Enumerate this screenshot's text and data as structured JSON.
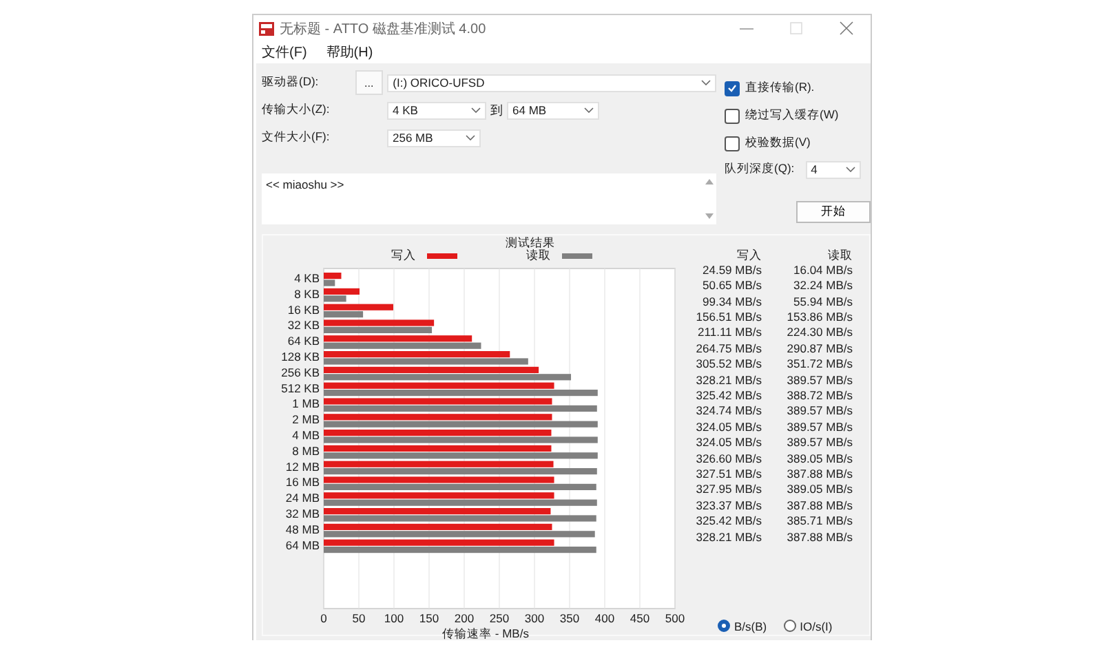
{
  "window": {
    "title": "无标题 - ATTO 磁盘基准测试 4.00"
  },
  "menu": [
    "文件(F)",
    "帮助(H)"
  ],
  "drive": {
    "label": "驱动器(D):",
    "browse_button": "...",
    "value": "(I:) ORICO-UFSD"
  },
  "transfer_size": {
    "label": "传输大小(Z):",
    "from": "4 KB",
    "to_label": "到",
    "to": "64 MB"
  },
  "file_size": {
    "label": "文件大小(F):",
    "value": "256 MB"
  },
  "options": [
    {
      "label": "直接传输(R).",
      "checked": true
    },
    {
      "label": "绕过写入缓存(W)",
      "checked": false
    },
    {
      "label": "校验数据(V)",
      "checked": false
    }
  ],
  "queue_depth": {
    "label": "队列深度(Q):",
    "value": "4"
  },
  "description": "<< miaoshu >>",
  "start_button": "开始",
  "results": {
    "chart_data": {
      "type": "bar",
      "orientation": "horizontal",
      "title": "测试结果",
      "xlabel": "传输速率 - MB/s",
      "categories": [
        "4 KB",
        "8 KB",
        "16 KB",
        "32 KB",
        "64 KB",
        "128 KB",
        "256 KB",
        "512 KB",
        "1 MB",
        "2 MB",
        "4 MB",
        "8 MB",
        "12 MB",
        "16 MB",
        "24 MB",
        "32 MB",
        "48 MB",
        "64 MB"
      ],
      "series": [
        {
          "name": "写入",
          "color": "#e21b1b",
          "values": [
            25,
            51,
            99,
            157,
            211,
            265,
            306,
            328,
            325,
            325,
            324,
            324,
            327,
            328,
            328,
            323,
            325,
            328
          ]
        },
        {
          "name": "读取",
          "color": "#808080",
          "values": [
            16,
            32,
            56,
            154,
            224,
            291,
            352,
            390,
            389,
            390,
            390,
            390,
            389,
            388,
            389,
            388,
            386,
            388
          ]
        }
      ],
      "xlim": [
        0,
        500
      ],
      "grid": true,
      "xticks": [
        0,
        50,
        100,
        150,
        200,
        250,
        300,
        350,
        400,
        450,
        500
      ]
    },
    "columns": [
      "写入",
      "读取"
    ],
    "rows": [
      [
        "24.59 MB/s",
        "16.04 MB/s"
      ],
      [
        "50.65 MB/s",
        "32.24 MB/s"
      ],
      [
        "99.34 MB/s",
        "55.94 MB/s"
      ],
      [
        "156.51 MB/s",
        "153.86 MB/s"
      ],
      [
        "211.11 MB/s",
        "224.30 MB/s"
      ],
      [
        "264.75 MB/s",
        "290.87 MB/s"
      ],
      [
        "305.52 MB/s",
        "351.72 MB/s"
      ],
      [
        "328.21 MB/s",
        "389.57 MB/s"
      ],
      [
        "325.42 MB/s",
        "388.72 MB/s"
      ],
      [
        "324.74 MB/s",
        "389.57 MB/s"
      ],
      [
        "324.05 MB/s",
        "389.57 MB/s"
      ],
      [
        "324.05 MB/s",
        "389.57 MB/s"
      ],
      [
        "326.60 MB/s",
        "389.05 MB/s"
      ],
      [
        "327.51 MB/s",
        "387.88 MB/s"
      ],
      [
        "327.95 MB/s",
        "389.05 MB/s"
      ],
      [
        "323.37 MB/s",
        "387.88 MB/s"
      ],
      [
        "325.42 MB/s",
        "385.71 MB/s"
      ],
      [
        "328.21 MB/s",
        "387.88 MB/s"
      ]
    ]
  },
  "units": [
    {
      "label": "B/s(B)",
      "selected": true
    },
    {
      "label": "IO/s(I)",
      "selected": false
    }
  ]
}
